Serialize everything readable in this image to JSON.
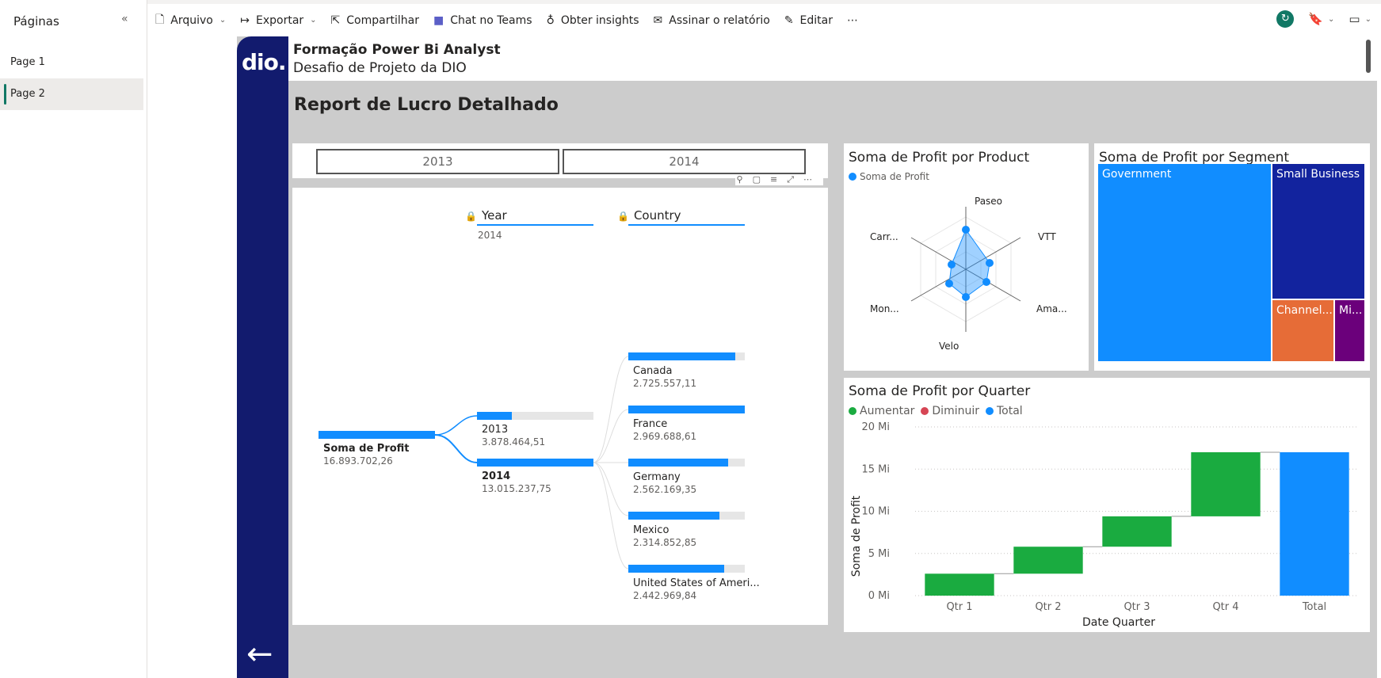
{
  "pages_pane": {
    "title": "Páginas",
    "items": [
      {
        "label": "Page 1"
      },
      {
        "label": "Page 2"
      }
    ]
  },
  "toolbar": {
    "file": "Arquivo",
    "export": "Exportar",
    "share": "Compartilhar",
    "teams": "Chat no Teams",
    "insights": "Obter insights",
    "subscribe": "Assinar o relatório",
    "edit": "Editar",
    "more": "⋯"
  },
  "report": {
    "logo_text": "dio.",
    "header_title": "Formação Power Bi Analyst",
    "header_subtitle": "Desafio de Projeto da DIO",
    "page_title": "Report de Lucro Detalhado"
  },
  "slicer": {
    "options": [
      "2013",
      "2014"
    ]
  },
  "decomposition_tree": {
    "level_headers": [
      "Year",
      "Country"
    ],
    "selected_year": "2014",
    "root": {
      "label": "Soma de Profit",
      "value": "16.893.702,26",
      "share": 1.0
    },
    "years": [
      {
        "label": "2013",
        "value": "3.878.464,51",
        "share": 0.3
      },
      {
        "label": "2014",
        "value": "13.015.237,75",
        "share": 1.0
      }
    ],
    "countries": [
      {
        "label": "Canada",
        "value": "2.725.557,11",
        "share": 0.92
      },
      {
        "label": "France",
        "value": "2.969.688,61",
        "share": 1.0
      },
      {
        "label": "Germany",
        "value": "2.562.169,35",
        "share": 0.86
      },
      {
        "label": "Mexico",
        "value": "2.314.852,85",
        "share": 0.78
      },
      {
        "label": "United States of Ameri...",
        "value": "2.442.969,84",
        "share": 0.82
      }
    ]
  },
  "radar_chart": {
    "title": "Soma de Profit por Product",
    "legend": "Soma de Profit",
    "axis_labels": [
      "Paseo",
      "VTT",
      "Ama...",
      "Velo",
      "Mon...",
      "Carr..."
    ]
  },
  "treemap": {
    "title": "Soma de Profit por Segment",
    "cells": [
      {
        "label": "Government",
        "color": "#118dff"
      },
      {
        "label": "Small Business",
        "color": "#12239e"
      },
      {
        "label": "Channel...",
        "color": "#e66c37"
      },
      {
        "label": "Mi...",
        "color": "#6b007b"
      }
    ]
  },
  "chart_data": {
    "type": "bar",
    "subtype": "waterfall",
    "title": "Soma de Profit por Quarter",
    "legend": [
      "Aumentar",
      "Diminuir",
      "Total"
    ],
    "legend_colors": {
      "Aumentar": "#1aab40",
      "Diminuir": "#d64554",
      "Total": "#118dff"
    },
    "xlabel": "Date Quarter",
    "ylabel": "Soma de Profit",
    "categories": [
      "Qtr 1",
      "Qtr 2",
      "Qtr 3",
      "Qtr 4",
      "Total"
    ],
    "values": [
      2.6,
      3.2,
      3.6,
      7.6,
      17.0
    ],
    "yticks": [
      "0 Mi",
      "5 Mi",
      "10 Mi",
      "15 Mi",
      "20 Mi"
    ],
    "ylim": [
      0,
      20
    ],
    "grid": true
  }
}
